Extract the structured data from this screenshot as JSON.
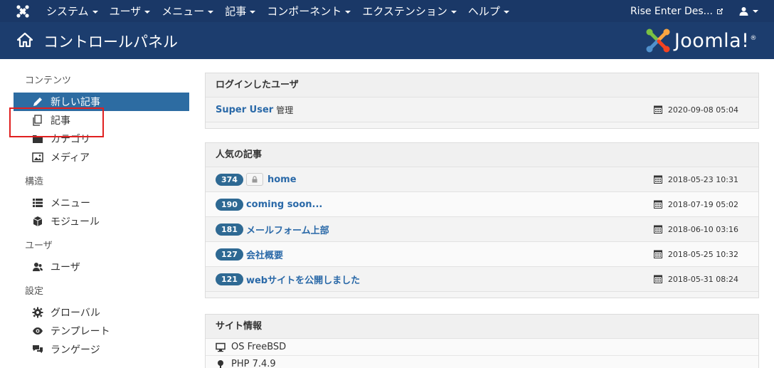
{
  "topbar": {
    "menu": [
      {
        "label": "システム"
      },
      {
        "label": "ユーザ"
      },
      {
        "label": "メニュー"
      },
      {
        "label": "記事"
      },
      {
        "label": "コンポーネント"
      },
      {
        "label": "エクステンション"
      },
      {
        "label": "ヘルプ"
      }
    ],
    "site_name": "Rise Enter Des...",
    "icons": {
      "logo": "joomla-icon",
      "external": "external-link-icon",
      "user": "user-icon"
    }
  },
  "header": {
    "title": "コントロールパネル",
    "brand_text": "Joomla!",
    "brand_reg": "®"
  },
  "sidebar": {
    "sections": [
      {
        "title": "コンテンツ",
        "items": [
          {
            "label": "新しい記事",
            "icon": "pencil-icon",
            "active": true
          },
          {
            "label": "記事",
            "icon": "copy-icon"
          },
          {
            "label": "カテゴリ",
            "icon": "folder-icon"
          },
          {
            "label": "メディア",
            "icon": "image-icon"
          }
        ]
      },
      {
        "title": "構造",
        "items": [
          {
            "label": "メニュー",
            "icon": "list-icon"
          },
          {
            "label": "モジュール",
            "icon": "cube-icon"
          }
        ]
      },
      {
        "title": "ユーザ",
        "items": [
          {
            "label": "ユーザ",
            "icon": "users-icon"
          }
        ]
      },
      {
        "title": "設定",
        "items": [
          {
            "label": "グローバル",
            "icon": "gear-icon"
          },
          {
            "label": "テンプレート",
            "icon": "eye-icon"
          },
          {
            "label": "ランゲージ",
            "icon": "comments-icon"
          }
        ]
      }
    ]
  },
  "logged_in": {
    "title": "ログインしたユーザ",
    "rows": [
      {
        "name": "Super User",
        "role": "管理",
        "date": "2020-09-08 05:04"
      }
    ]
  },
  "popular": {
    "title": "人気の記事",
    "rows": [
      {
        "hits": "374",
        "title": "home",
        "locked": true,
        "date": "2018-05-23 10:31"
      },
      {
        "hits": "190",
        "title": "coming soon...",
        "locked": false,
        "date": "2018-07-19 05:02"
      },
      {
        "hits": "181",
        "title": "メールフォーム上部",
        "locked": false,
        "date": "2018-06-10 03:16"
      },
      {
        "hits": "127",
        "title": "会社概要",
        "locked": false,
        "date": "2018-05-25 10:32"
      },
      {
        "hits": "121",
        "title": "webサイトを公開しました",
        "locked": false,
        "date": "2018-05-31 08:24"
      }
    ]
  },
  "site_info": {
    "title": "サイト情報",
    "rows": [
      {
        "label": "OS FreeBSD",
        "icon": "monitor-icon"
      },
      {
        "label": "PHP 7.4.9",
        "icon": "key-icon"
      }
    ]
  },
  "colors": {
    "topbar": "#1a3867",
    "header": "#1c3d6e",
    "active": "#2d6ca2",
    "badge": "#2e6993",
    "link": "#2a69a8",
    "highlight": "#e02020"
  }
}
